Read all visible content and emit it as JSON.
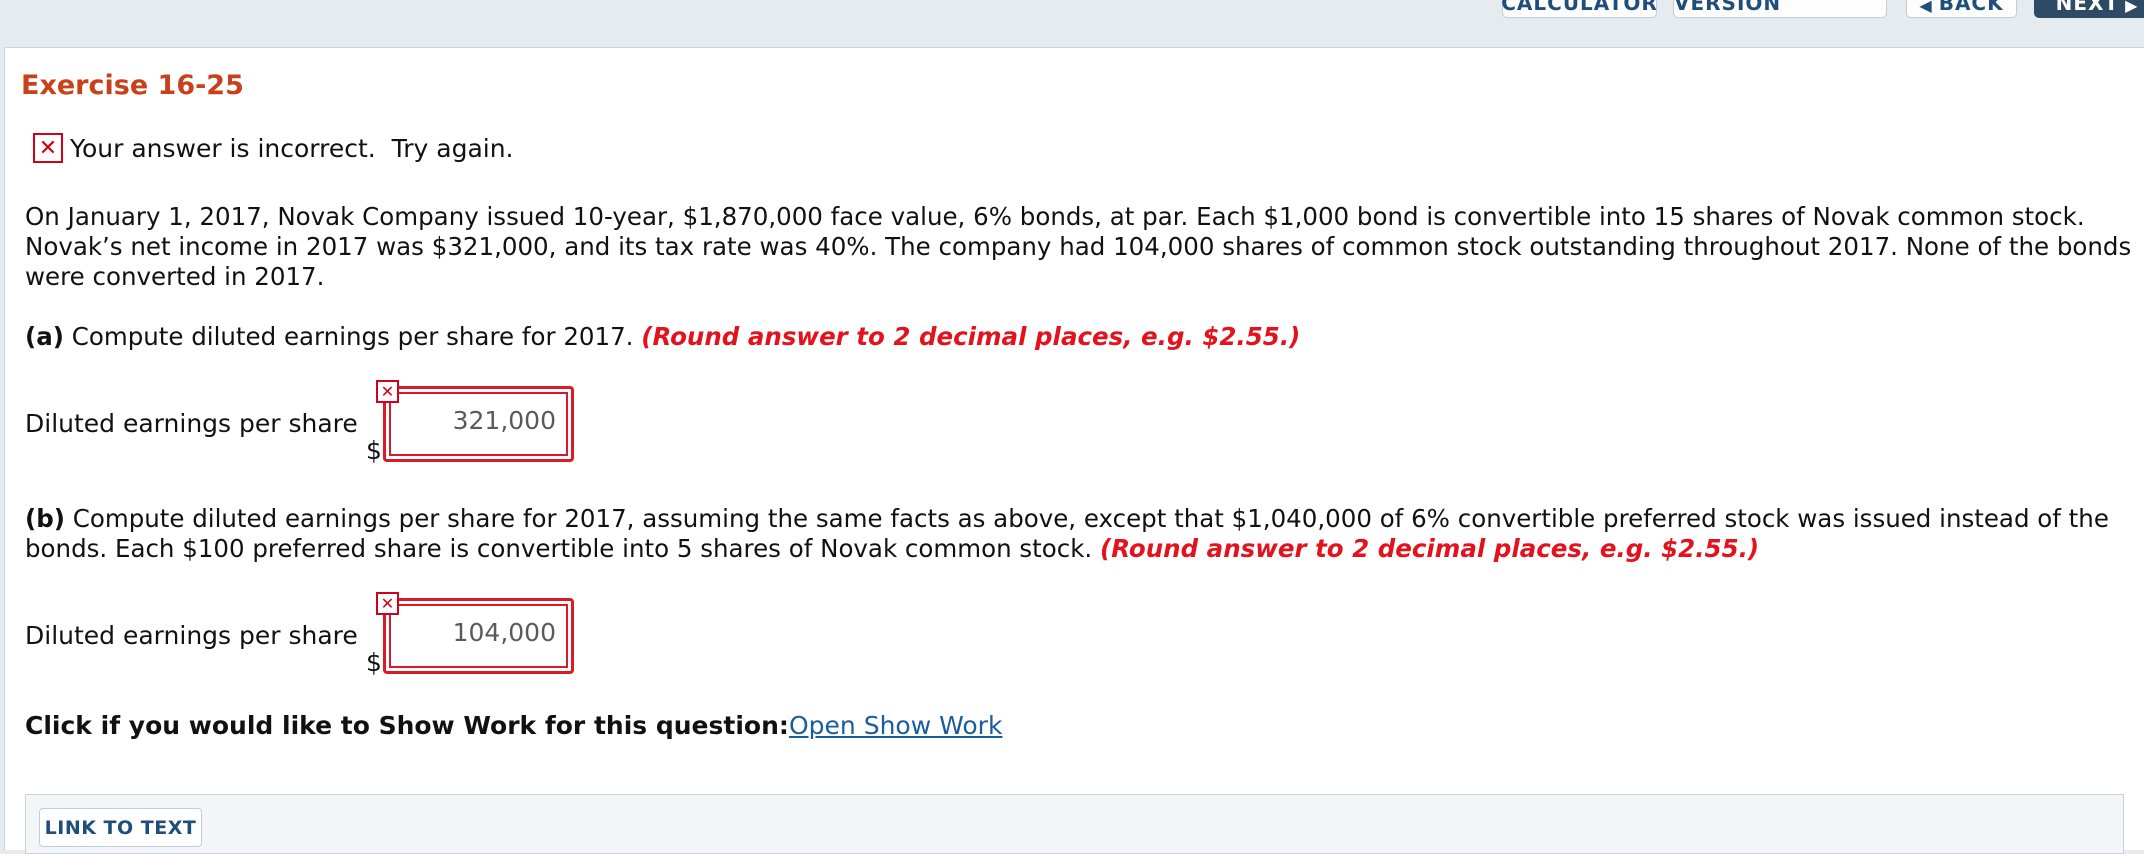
{
  "toolbar": {
    "calculator": "CALCULATOR",
    "printer": "PRINTER VERSION",
    "back": "BACK",
    "next": "NEXT"
  },
  "exercise_title": "Exercise 16-25",
  "status": {
    "icon": "x-icon",
    "message": "Your answer is incorrect.  Try again."
  },
  "problem": {
    "line1": "On January 1, 2017, Novak Company issued 10-year, $1,870,000 face value, 6% bonds, at par. Each $1,000 bond is convertible into 15 shares of Novak common stock.",
    "line2": "Novak’s net income in 2017 was $321,000, and its tax rate was 40%. The company had 104,000 shares of common stock outstanding throughout 2017. None of the bonds",
    "line3": "were converted in 2017."
  },
  "part_a": {
    "marker": "(a)",
    "question": "Compute diluted earnings per share for 2017.",
    "hint": "(Round answer to 2 decimal places, e.g. $2.55.)",
    "field_label": "Diluted earnings per share",
    "currency": "$",
    "value": "321,000"
  },
  "part_b": {
    "marker": "(b)",
    "question_line1": "Compute diluted earnings per share for 2017, assuming the same facts as above, except that $1,040,000 of 6% convertible preferred stock was issued instead of the",
    "question_line2": "bonds. Each $100 preferred share is convertible into 5 shares of Novak common stock.",
    "hint": "(Round answer to 2 decimal places, e.g. $2.55.)",
    "field_label": "Diluted earnings per share",
    "currency": "$",
    "value": "104,000"
  },
  "show_work": {
    "prompt": "Click if you would like to Show Work for this question:",
    "link": "Open Show Work"
  },
  "link_to_text": "LINK TO TEXT",
  "colors": {
    "title": "#c8411b",
    "error": "#d81b27",
    "hint": "#e4121c",
    "link": "#1a5c9c",
    "toolbar_text": "#1f4e7a"
  }
}
